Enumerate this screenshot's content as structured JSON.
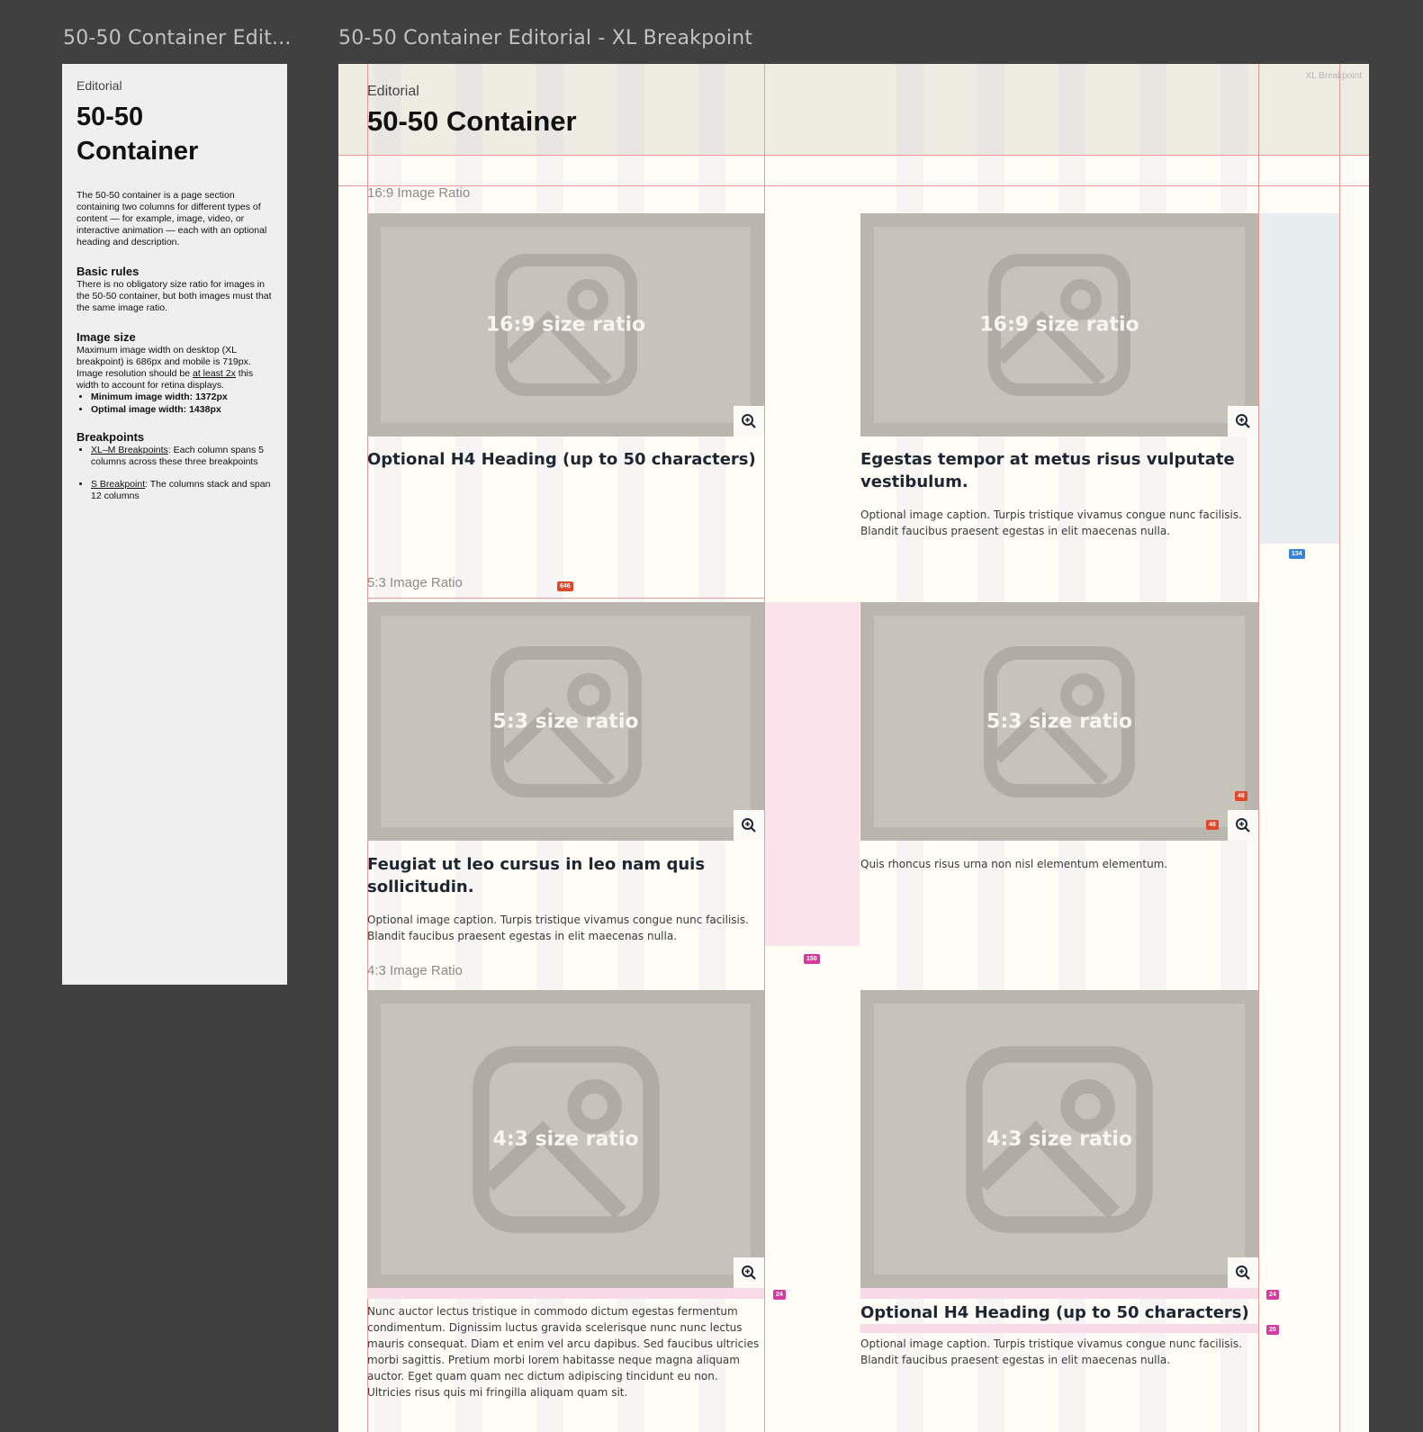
{
  "frames": {
    "left_title": "50-50 Container Edit...",
    "main_title": "50-50 Container Editorial - XL Breakpoint"
  },
  "doc": {
    "eyebrow": "Editorial",
    "title_line1": "50-50",
    "title_line2": "Container",
    "intro": "The 50-50 container is a page section containing two columns for different types of content — for example, image, video, or interactive animation — each with an optional heading and description.",
    "basic_rules_heading": "Basic rules",
    "basic_rules_text": "There is no obligatory size ratio for images in the 50-50 container, but both images must that the same image ratio.",
    "image_size_heading": "Image size",
    "image_size_text_a": "Maximum image width on desktop (XL breakpoint) is 686px and mobile is 719px. Image resolution should be ",
    "image_size_link": "at least 2x",
    "image_size_text_b": " this width to account for retina displays.",
    "min_width": "Minimum image width: 1372px",
    "opt_width": "Optimal image width: 1438px",
    "breakpoints_heading": "Breakpoints",
    "bp1_link": "XL–M Breakpoints",
    "bp1_text": ": Each column spans 5 columns across these three breakpoints",
    "bp2_link": "S Breakpoint",
    "bp2_text": ": The columns stack and span 12 columns"
  },
  "board": {
    "eyebrow": "Editorial",
    "title": "50-50 Container",
    "bp_label": "XL Breakpoint",
    "sections": [
      {
        "label": "16:9 Image Ratio",
        "left": {
          "ratio": "16:9 size ratio",
          "heading": "Optional H4 Heading (up to 50 characters)",
          "caption": ""
        },
        "right": {
          "ratio": "16:9 size ratio",
          "heading": "Egestas tempor at metus risus vulputate vestibulum.",
          "caption": "Optional image caption. Turpis tristique vivamus congue nunc facilisis. Blandit faucibus praesent egestas in elit maecenas nulla."
        }
      },
      {
        "label": "5:3 Image Ratio",
        "left": {
          "ratio": "5:3 size ratio",
          "heading": "Feugiat ut leo cursus in leo nam quis sollicitudin.",
          "caption": "Optional image caption. Turpis tristique vivamus congue nunc facilisis. Blandit faucibus praesent egestas in elit maecenas nulla."
        },
        "right": {
          "ratio": "5:3 size ratio",
          "heading": "",
          "caption": "Quis rhoncus risus urna non nisl elementum elementum."
        }
      },
      {
        "label": "4:3 Image Ratio",
        "left": {
          "ratio": "4:3 size ratio",
          "heading": "",
          "caption": "Nunc auctor lectus tristique in commodo dictum egestas fermentum condimentum. Dignissim luctus gravida scelerisque nunc nunc lectus mauris consequat. Diam et enim vel arcu dapibus. Sed faucibus ultricies morbi sagittis. Pretium morbi lorem habitasse neque magna aliquam auctor. Eget quam quam nec dictum adipiscing tincidunt eu non. Ultricies risus quis mi fringilla aliquam quam sit."
        },
        "right": {
          "ratio": "4:3 size ratio",
          "heading": "Optional H4 Heading (up to 50 characters)",
          "caption": "Optional image caption. Turpis tristique vivamus congue nunc facilisis. Blandit faucibus praesent egestas in elit maecenas nulla."
        }
      }
    ],
    "badges": {
      "col_width": "646",
      "side_gutter": "134",
      "col_gap": "150",
      "zoom_pad_v": "48",
      "zoom_pad_h": "48",
      "cap_gap_left": "24",
      "cap_gap_right": "24",
      "head_gap": "20"
    }
  },
  "colors": {
    "background": "#404040",
    "redline": "#e89a9a",
    "placeholder": "#bab6ae",
    "heading": "#1d2733"
  },
  "icons": {
    "zoom": "zoom-in-icon",
    "image": "image-placeholder-icon"
  }
}
